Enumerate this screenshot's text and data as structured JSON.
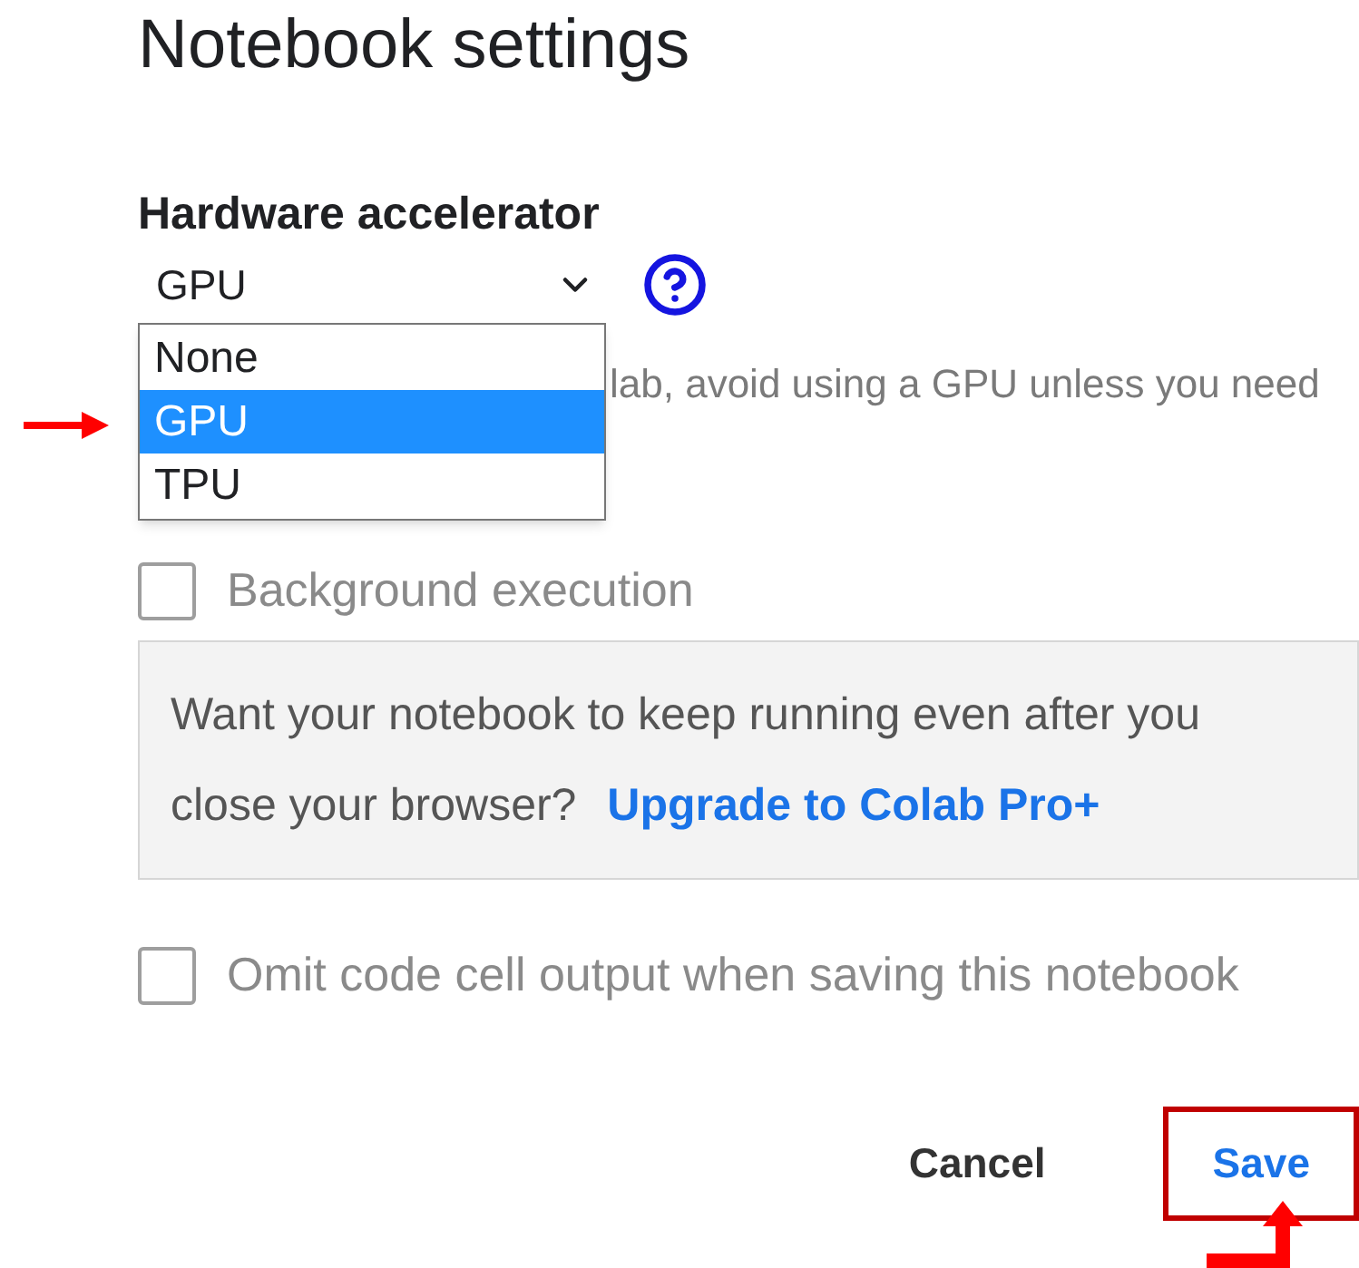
{
  "dialog_title": "Notebook settings",
  "hardware_accelerator": {
    "label": "Hardware accelerator",
    "value": "GPU",
    "open": true,
    "options": [
      {
        "label": "None",
        "selected": false
      },
      {
        "label": "GPU",
        "selected": true
      },
      {
        "label": "TPU",
        "selected": false
      }
    ]
  },
  "hint": "lab, avoid using a GPU unless you need",
  "background_execution": {
    "label": "Background execution",
    "checked": false,
    "disabled": true
  },
  "upsell": {
    "text": "Want your notebook to keep running even after you close your browser?",
    "link": "Upgrade to Colab Pro+"
  },
  "omit_output": {
    "label": "Omit code cell output when saving this notebook",
    "checked": false
  },
  "buttons": [
    {
      "label": "Cancel",
      "kind": "text",
      "highlighted": false
    },
    {
      "label": "Save",
      "kind": "primary",
      "highlighted": true
    }
  ]
}
